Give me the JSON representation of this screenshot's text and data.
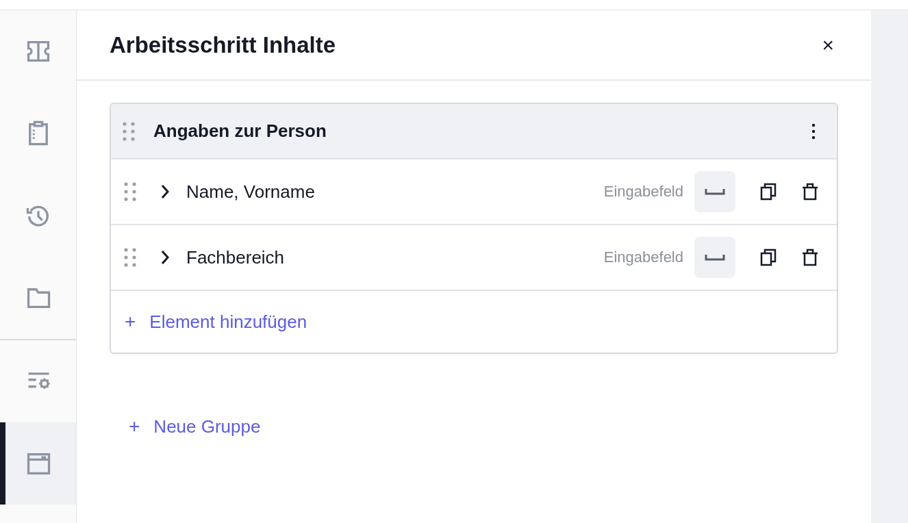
{
  "sidebar": {
    "top_items": [
      {
        "selected": false
      },
      {
        "selected": false
      },
      {
        "selected": false
      },
      {
        "selected": false
      }
    ],
    "bottom_items": [
      {
        "selected": false
      },
      {
        "selected": true
      }
    ]
  },
  "panel": {
    "title": "Arbeitsschritt Inhalte",
    "close": "×",
    "groups": [
      {
        "title": "Angaben zur Person",
        "elements": [
          {
            "label": "Name, Vorname",
            "type_label": "Eingabefeld",
            "expanded": false
          },
          {
            "label": "Fachbereich",
            "type_label": "Eingabefeld",
            "expanded": false
          }
        ],
        "add_element": {
          "icon": "+",
          "label": "Element hinzufügen"
        }
      }
    ],
    "new_group": {
      "icon": "+",
      "label": "Neue Gruppe"
    }
  }
}
